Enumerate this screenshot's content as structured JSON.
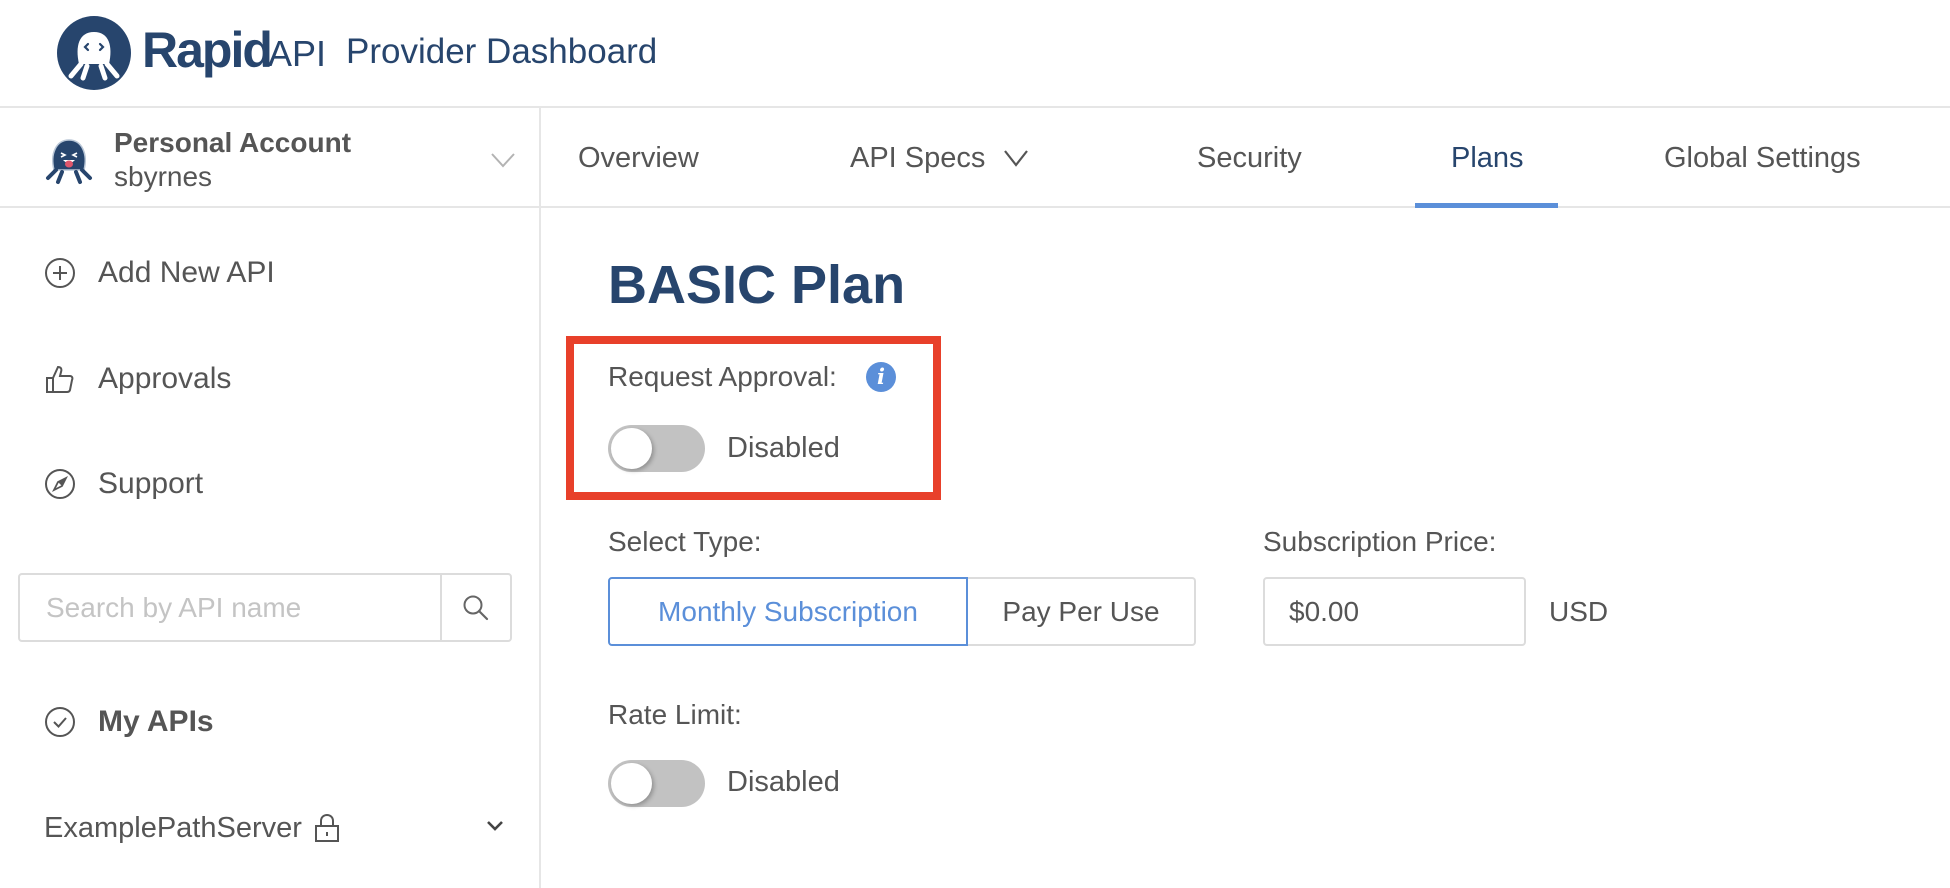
{
  "header": {
    "logo_brand": "Rapid",
    "logo_suffix": "API",
    "title": "Provider Dashboard"
  },
  "account": {
    "name": "Personal Account",
    "username": "sbyrnes"
  },
  "sidebar": {
    "items": [
      {
        "label": "Add New API",
        "icon": "plus-circle-icon"
      },
      {
        "label": "Approvals",
        "icon": "thumbs-up-icon"
      },
      {
        "label": "Support",
        "icon": "compass-icon"
      }
    ],
    "search": {
      "placeholder": "Search by API name",
      "value": ""
    },
    "my_apis_label": "My APIs",
    "apis": [
      {
        "name": "ExamplePathServer",
        "private": true
      }
    ]
  },
  "tabs": [
    {
      "label": "Overview",
      "active": false
    },
    {
      "label": "API Specs",
      "active": false,
      "has_dropdown": true
    },
    {
      "label": "Security",
      "active": false
    },
    {
      "label": "Plans",
      "active": true
    },
    {
      "label": "Global Settings",
      "active": false
    }
  ],
  "plan": {
    "title": "BASIC Plan",
    "request_approval": {
      "label": "Request Approval:",
      "enabled": false,
      "status_text": "Disabled"
    },
    "select_type": {
      "label": "Select Type:",
      "options": [
        "Monthly Subscription",
        "Pay Per Use"
      ],
      "selected": "Monthly Subscription"
    },
    "subscription_price": {
      "label": "Subscription Price:",
      "value": "$0.00",
      "currency": "USD"
    },
    "rate_limit": {
      "label": "Rate Limit:",
      "enabled": false,
      "status_text": "Disabled"
    }
  },
  "colors": {
    "brand": "#27456d",
    "accent": "#5b8fd9",
    "highlight": "#e8402a",
    "toggle_off": "#c2c2c2"
  }
}
